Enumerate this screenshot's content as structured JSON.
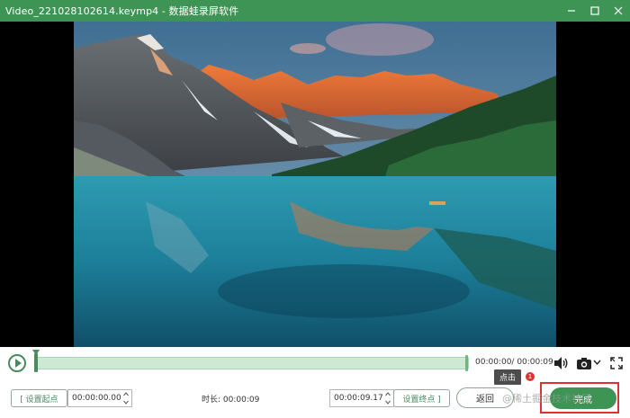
{
  "window": {
    "title": "Video_221028102614.keymp4  -  数据蛙录屏软件"
  },
  "player": {
    "time_readout": "00:00:00/ 00:00:09",
    "progress_fraction": 0.0
  },
  "tooltip": {
    "label": "点击",
    "badge": "1"
  },
  "trim": {
    "set_start_label": "[ 设置起点",
    "start_time": "00:00:00.00",
    "duration_text": "时长:  00:00:09",
    "end_time": "00:00:09.17",
    "set_end_label": "设置终点 ]"
  },
  "actions": {
    "back_label": "返回",
    "done_label": "完成"
  },
  "watermark": "@稀土掘金技术社区",
  "colors": {
    "titlebar": "#3d9454",
    "accent": "#4a8a5e",
    "track": "#cde8d3",
    "highlight": "#e03131"
  }
}
